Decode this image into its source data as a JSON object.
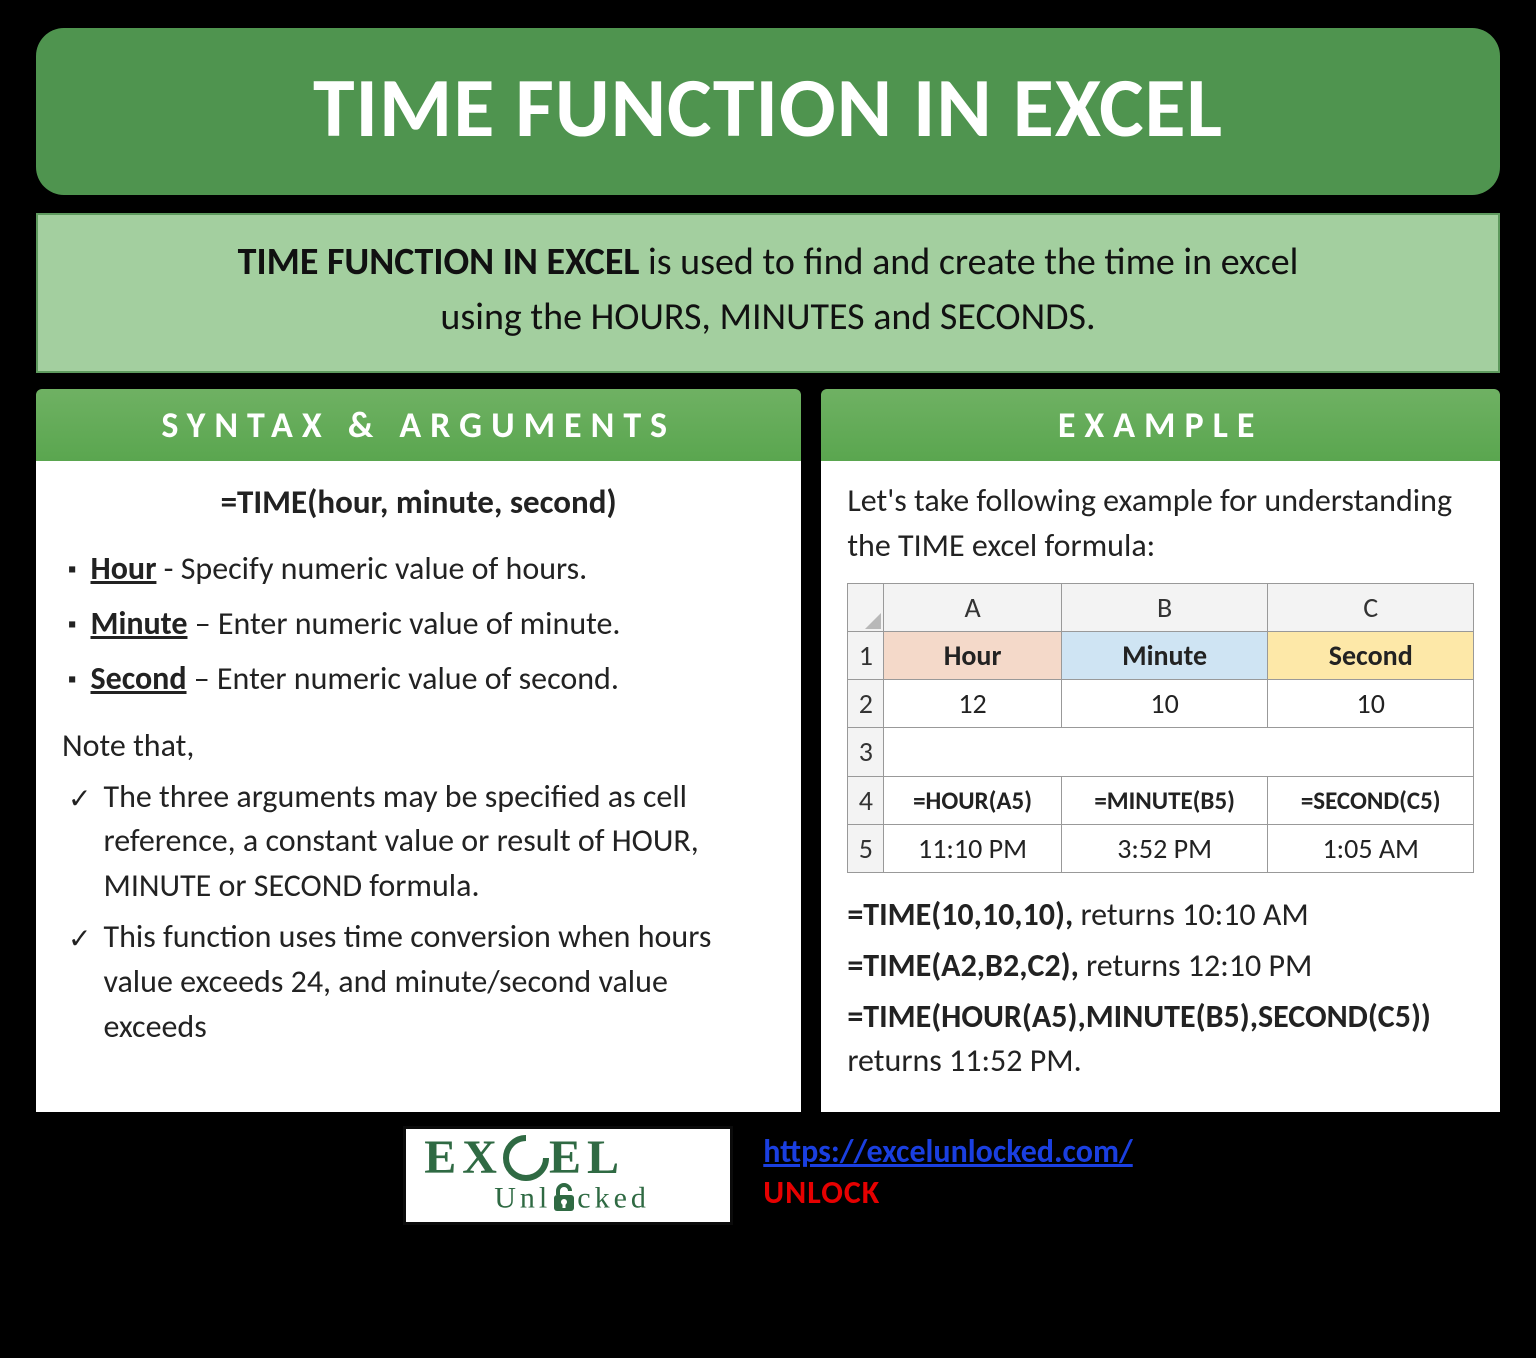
{
  "title": "TIME FUNCTION IN EXCEL",
  "intro": {
    "strong": "TIME FUNCTION IN EXCEL",
    "rest1": " is used to find and create the time in excel",
    "rest2": "using the HOURS, MINUTES and SECONDS."
  },
  "panels": {
    "syntax_header": "SYNTAX & ARGUMENTS",
    "example_header": "EXAMPLE"
  },
  "syntax": {
    "formula": "=TIME(hour, minute, second)",
    "args": [
      {
        "name": "Hour",
        "desc": " - Specify numeric value of hours."
      },
      {
        "name": "Minute",
        "desc": " – Enter numeric value of minute."
      },
      {
        "name": "Second",
        "desc": " – Enter numeric value of second."
      }
    ],
    "note_lead": "Note that,",
    "notes": [
      "The three arguments may be specified as cell reference, a constant value or result of HOUR, MINUTE or SECOND formula.",
      "This function uses time conversion when hours value exceeds 24, and minute/second value exceeds"
    ]
  },
  "example": {
    "intro": "Let's take following example for understanding the TIME excel formula:",
    "table": {
      "col_heads": [
        "A",
        "B",
        "C"
      ],
      "row1_labels": [
        "Hour",
        "Minute",
        "Second"
      ],
      "row2_values": [
        "12",
        "10",
        "10"
      ],
      "row4_formulas": [
        "=HOUR(A5)",
        "=MINUTE(B5)",
        "=SECOND(C5)"
      ],
      "row5_values": [
        "11:10 PM",
        "3:52 PM",
        "1:05 AM"
      ]
    },
    "lines": [
      {
        "f": "=TIME(10,10,10),",
        "r": " returns 10:10 AM"
      },
      {
        "f": "=TIME(A2,B2,C2),",
        "r": " returns 12:10 PM"
      },
      {
        "f": "=TIME(HOUR(A5),MINUTE(B5),SECOND(C5))",
        "r": " returns 11:52 PM."
      }
    ]
  },
  "footer": {
    "logo_top": "EX   EL",
    "logo_bot": "Unl   cked",
    "url": "https://excelunlocked.com/",
    "unlock": "UNLOCK"
  }
}
